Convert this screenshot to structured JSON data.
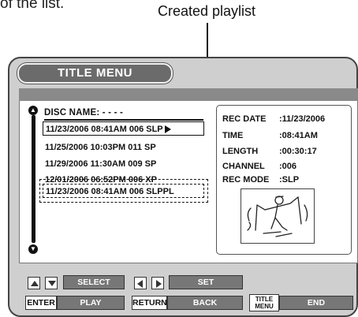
{
  "top_fragment": "of the list.",
  "callout_label": "Created playlist",
  "menu_title": "TITLE MENU",
  "disc_name": "DISC NAME: - - - -",
  "titles": [
    {
      "date": "11/23/2006",
      "time": "08:41AM",
      "ch": "006",
      "mode": "SLP"
    },
    {
      "date": "11/25/2006",
      "time": "10:03PM",
      "ch": "011",
      "mode": "SP"
    },
    {
      "date": "11/29/2006",
      "time": "11:30AM",
      "ch": "009",
      "mode": "SP"
    },
    {
      "date": "12/01/2006",
      "time": "06:52PM",
      "ch": "006",
      "mode": "XP"
    },
    {
      "date": "11/23/2006",
      "time": "08:41AM",
      "ch": "006",
      "mode": "SLP",
      "suffix": "PL"
    }
  ],
  "info": [
    {
      "label": "REC DATE",
      "value": ":11/23/2006"
    },
    {
      "label": "TIME",
      "value": ":08:41AM"
    },
    {
      "label": "LENGTH",
      "value": ":00:30:17"
    },
    {
      "label": "CHANNEL",
      "value": ":006"
    },
    {
      "label": "REC MODE",
      "value": ":SLP"
    }
  ],
  "footer": {
    "select": "SELECT",
    "set": "SET",
    "enter": "ENTER",
    "play": "PLAY",
    "return": "RETURN",
    "back": "BACK",
    "title_menu": "TITLE MENU",
    "end": "END"
  },
  "icons": [
    "up-arrow-icon",
    "down-arrow-icon",
    "left-arrow-icon",
    "right-arrow-icon",
    "play-triangle-icon",
    "skier-thumbnail"
  ]
}
